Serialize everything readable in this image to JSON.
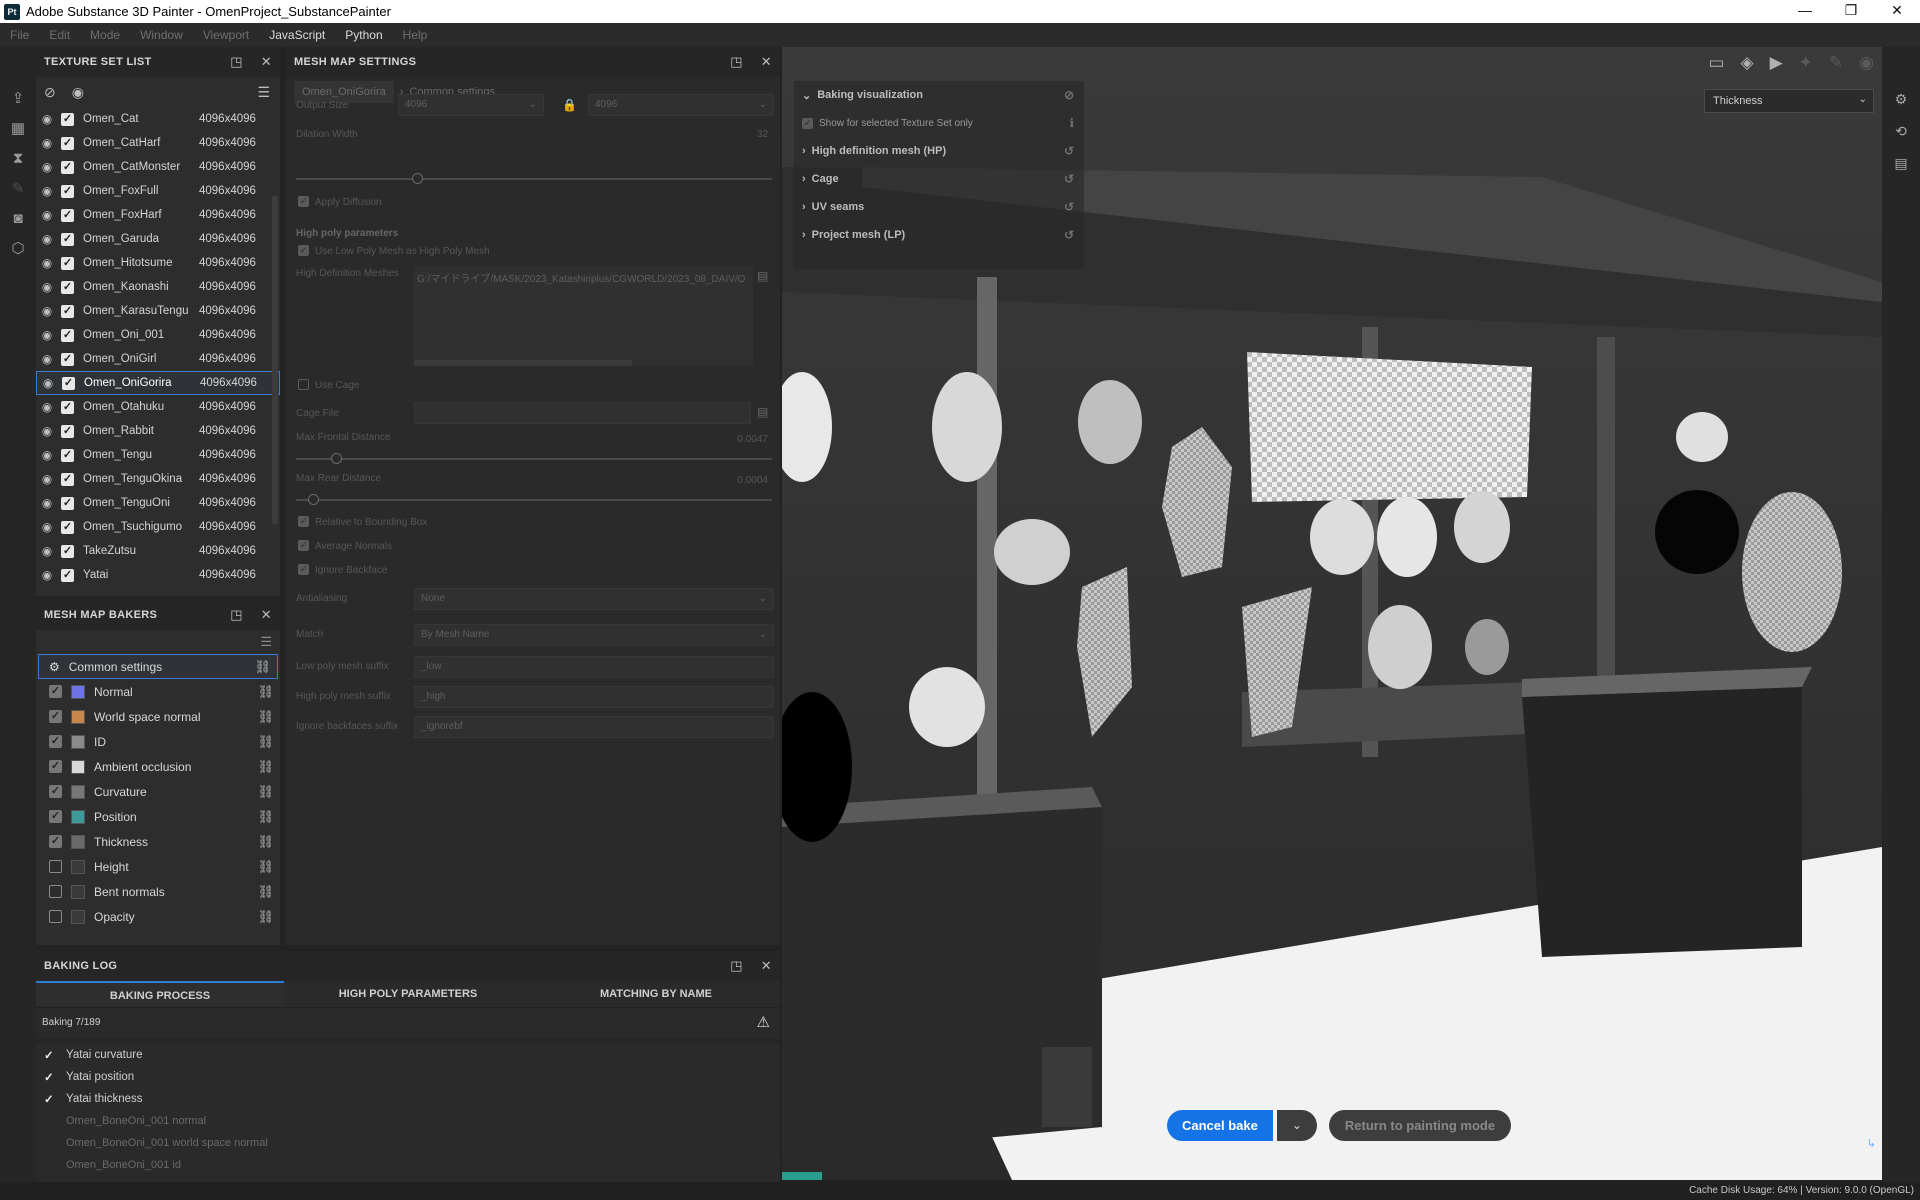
{
  "window": {
    "logo": "Pt",
    "title": "Adobe Substance 3D Painter - OmenProject_SubstancePainter",
    "controls": [
      "—",
      "❐",
      "✕"
    ]
  },
  "menu": [
    "File",
    "Edit",
    "Mode",
    "Window",
    "Viewport",
    "JavaScript",
    "Python",
    "Help"
  ],
  "texture_set_list": {
    "title": "TEXTURE SET LIST",
    "items": [
      {
        "name": "Omen_Cat",
        "res": "4096x4096"
      },
      {
        "name": "Omen_CatHarf",
        "res": "4096x4096"
      },
      {
        "name": "Omen_CatMonster",
        "res": "4096x4096"
      },
      {
        "name": "Omen_FoxFull",
        "res": "4096x4096"
      },
      {
        "name": "Omen_FoxHarf",
        "res": "4096x4096"
      },
      {
        "name": "Omen_Garuda",
        "res": "4096x4096"
      },
      {
        "name": "Omen_Hitotsume",
        "res": "4096x4096"
      },
      {
        "name": "Omen_Kaonashi",
        "res": "4096x4096"
      },
      {
        "name": "Omen_KarasuTengu",
        "res": "4096x4096"
      },
      {
        "name": "Omen_Oni_001",
        "res": "4096x4096"
      },
      {
        "name": "Omen_OniGirl",
        "res": "4096x4096"
      },
      {
        "name": "Omen_OniGorira",
        "res": "4096x4096"
      },
      {
        "name": "Omen_Otahuku",
        "res": "4096x4096"
      },
      {
        "name": "Omen_Rabbit",
        "res": "4096x4096"
      },
      {
        "name": "Omen_Tengu",
        "res": "4096x4096"
      },
      {
        "name": "Omen_TenguOkina",
        "res": "4096x4096"
      },
      {
        "name": "Omen_TenguOni",
        "res": "4096x4096"
      },
      {
        "name": "Omen_Tsuchigumo",
        "res": "4096x4096"
      },
      {
        "name": "TakeZutsu",
        "res": "4096x4096"
      },
      {
        "name": "Yatai",
        "res": "4096x4096"
      }
    ],
    "selected": "Omen_OniGorira"
  },
  "mesh_map_bakers": {
    "title": "MESH MAP BAKERS",
    "common": "Common settings",
    "items": [
      {
        "label": "Normal",
        "checked": true,
        "color": "#6f73e8"
      },
      {
        "label": "World space normal",
        "checked": true,
        "color": "#c9884b"
      },
      {
        "label": "ID",
        "checked": true,
        "color": "#8a8a8a"
      },
      {
        "label": "Ambient occlusion",
        "checked": true,
        "color": "#d9d9d9"
      },
      {
        "label": "Curvature",
        "checked": true,
        "color": "#777777"
      },
      {
        "label": "Position",
        "checked": true,
        "color": "#3e9a98"
      },
      {
        "label": "Thickness",
        "checked": true,
        "color": "#6a6a6a"
      },
      {
        "label": "Height",
        "checked": false,
        "color": "#3a3a3a"
      },
      {
        "label": "Bent normals",
        "checked": false,
        "color": "#3a3a3a"
      },
      {
        "label": "Opacity",
        "checked": false,
        "color": "#3a3a3a"
      }
    ]
  },
  "mesh_map_settings": {
    "title": "MESH MAP SETTINGS",
    "breadcrumb": [
      "Omen_OniGorira",
      "Common settings"
    ],
    "output_size_label": "Output Size",
    "output_size_a": "4096",
    "output_size_b": "4096",
    "dilation_label": "Dilation Width",
    "dilation_value": "32",
    "apply_diffusion": "Apply Diffusion",
    "hp_section": "High poly parameters",
    "use_low_as_high": "Use Low Poly Mesh as High Poly Mesh",
    "hd_meshes_label": "High Definition Meshes",
    "hd_meshes_path": "G:/マイドライブ/MASK/2023_Katashiriplus/CGWORLD/2023_08_DAIV/O",
    "use_cage": "Use Cage",
    "cage_file": "Cage File",
    "max_frontal_label": "Max Frontal Distance",
    "max_frontal_value": "0.0047",
    "max_rear_label": "Max Rear Distance",
    "max_rear_value": "0.0004",
    "relative_bbox": "Relative to Bounding Box",
    "average_normals": "Average Normals",
    "ignore_backface": "Ignore Backface",
    "antialiasing_label": "Antialiasing",
    "antialiasing_value": "None",
    "match_label": "Match",
    "match_value": "By Mesh Name",
    "low_suffix_label": "Low poly mesh suffix",
    "low_suffix_value": "_low",
    "high_suffix_label": "High poly mesh suffix",
    "high_suffix_value": "_high",
    "ignore_suffix_label": "Ignore backfaces suffix",
    "ignore_suffix_value": "_ignorebf"
  },
  "baking_log": {
    "title": "BAKING LOG",
    "tabs": [
      "BAKING PROCESS",
      "HIGH POLY PARAMETERS",
      "MATCHING BY NAME"
    ],
    "progress_text": "Baking 7/189",
    "done": [
      "Yatai curvature",
      "Yatai position",
      "Yatai thickness"
    ],
    "pending": [
      "Omen_BoneOni_001 normal",
      "Omen_BoneOni_001 world space normal",
      "Omen_BoneOni_001 id"
    ]
  },
  "viewport": {
    "channel": "Thickness",
    "baking_vis": {
      "title": "Baking visualization",
      "show_selected": "Show for selected Texture Set only",
      "sections": [
        "High definition mesh (HP)",
        "Cage",
        "UV seams",
        "Project mesh (LP)"
      ]
    },
    "cancel_bake": "Cancel bake",
    "return_paint": "Return to painting mode"
  },
  "status": {
    "text": "Cache Disk Usage:  64% | Version: 9.0.0 (OpenGL)"
  }
}
